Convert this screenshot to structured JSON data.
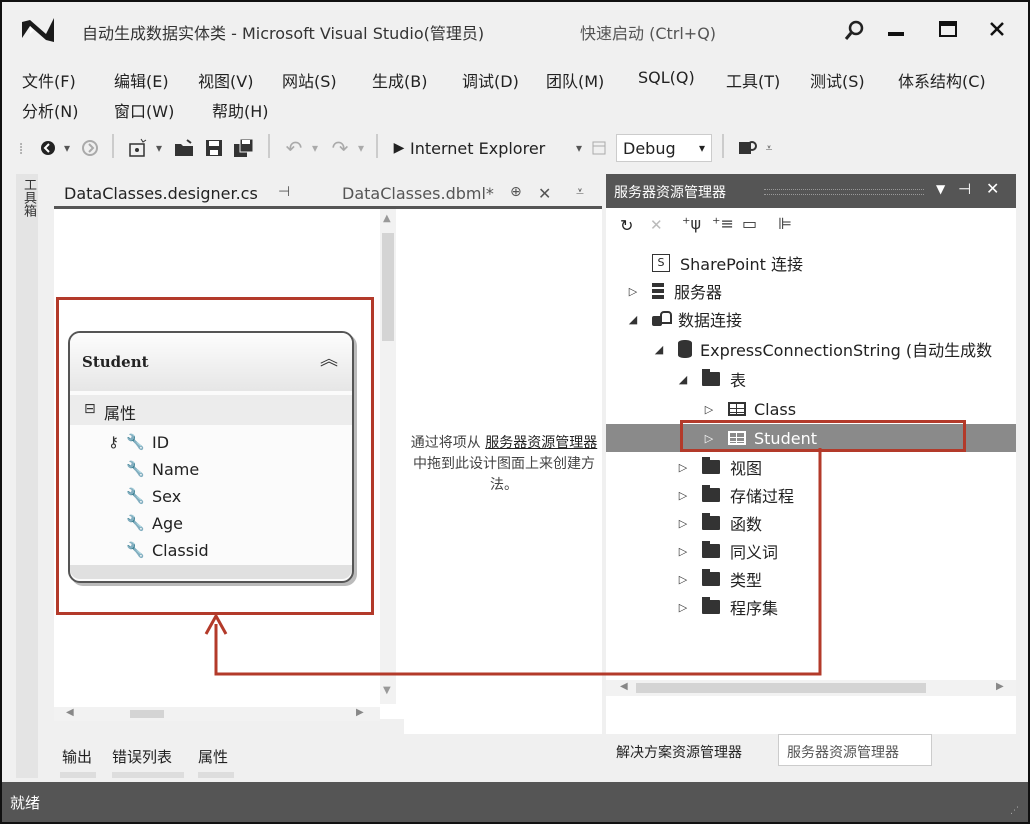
{
  "window": {
    "title": "自动生成数据实体类 - Microsoft Visual Studio(管理员)",
    "quick_launch": "快速启动 (Ctrl+Q)",
    "minimize": "—",
    "maximize": "☐",
    "close": "✕"
  },
  "menu": {
    "row1": [
      "文件(F)",
      "编辑(E)",
      "视图(V)",
      "网站(S)",
      "生成(B)",
      "调试(D)",
      "团队(M)",
      "SQL(Q)",
      "工具(T)",
      "测试(S)",
      "体系结构(C)"
    ],
    "row2": [
      "分析(N)",
      "窗口(W)",
      "帮助(H)"
    ]
  },
  "toolbar": {
    "browser": "Internet Explorer",
    "config": "Debug"
  },
  "left_strip": {
    "label": "工具箱"
  },
  "tabs": {
    "designer_cs": "DataClasses.designer.cs",
    "dbml": "DataClasses.dbml*",
    "pin": "⊕",
    "close": "✕"
  },
  "entity": {
    "name": "Student",
    "section": "属性",
    "fields": [
      "ID",
      "Name",
      "Sex",
      "Age",
      "Classid"
    ]
  },
  "hint": {
    "p1": "通过将项从 ",
    "link": "服务器资源管理器",
    "p2": " 中拖到此设计图面上来创建方法。"
  },
  "server_explorer": {
    "title": "服务器资源管理器",
    "items": {
      "sharepoint": "SharePoint 连接",
      "servers": "服务器",
      "data_connections": "数据连接",
      "connection": "ExpressConnectionString (自动生成数",
      "tables": "表",
      "class_table": "Class",
      "student_table": "Student",
      "views": "视图",
      "procs": "存储过程",
      "functions": "函数",
      "synonyms": "同义词",
      "types": "类型",
      "assemblies": "程序集"
    },
    "bottom_tabs": [
      "解决方案资源管理器",
      "服务器资源管理器"
    ]
  },
  "bottom_tabs": [
    "输出",
    "错误列表",
    "属性"
  ],
  "status": "就绪",
  "colors": {
    "highlight": "#b33a2a",
    "selected_row": "#8a8a8a",
    "status_bar": "#555555"
  }
}
